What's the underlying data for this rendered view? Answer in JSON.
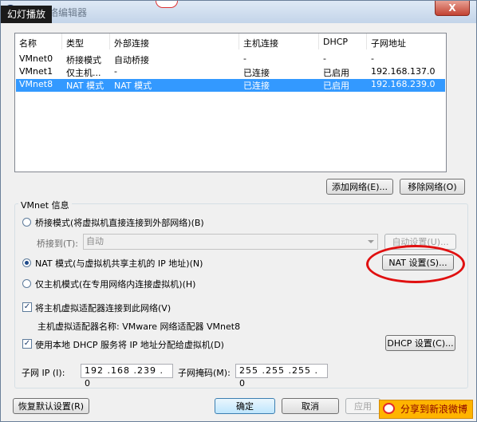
{
  "window": {
    "title": "虚拟网络编辑器",
    "close_label": "X"
  },
  "overlay": {
    "slideshow_label": "幻灯播放",
    "share_label": "分享到新浪微博"
  },
  "table": {
    "headers": [
      "名称",
      "类型",
      "外部连接",
      "主机连接",
      "DHCP",
      "子网地址"
    ],
    "rows": [
      {
        "name": "VMnet0",
        "type": "桥接模式",
        "external": "自动桥接",
        "host": "-",
        "dhcp": "-",
        "subnet": "-"
      },
      {
        "name": "VMnet1",
        "type": "仅主机...",
        "external": "-",
        "host": "已连接",
        "dhcp": "已启用",
        "subnet": "192.168.137.0"
      },
      {
        "name": "VMnet8",
        "type": "NAT 模式",
        "external": "NAT 模式",
        "host": "已连接",
        "dhcp": "已启用",
        "subnet": "192.168.239.0"
      }
    ],
    "selected_index": 2
  },
  "buttons": {
    "add_network": "添加网络(E)...",
    "remove_network": "移除网络(O)",
    "auto_settings": "自动设置(U)...",
    "nat_settings": "NAT 设置(S)...",
    "dhcp_settings": "DHCP 设置(C)...",
    "restore_defaults": "恢复默认设置(R)",
    "ok": "确定",
    "cancel": "取消",
    "apply": "应用"
  },
  "vmnet_info": {
    "group_title": "VMnet 信息",
    "bridge_mode": "桥接模式(将虚拟机直接连接到外部网络)(B)",
    "bridge_to_label": "桥接到(T):",
    "bridge_to_value": "自动",
    "nat_mode": "NAT 模式(与虚拟机共享主机的 IP 地址)(N)",
    "host_only_mode": "仅主机模式(在专用网络内连接虚拟机)(H)",
    "selected_mode": "nat",
    "connect_adapter": "将主机虚拟适配器连接到此网络(V)",
    "connect_adapter_checked": true,
    "adapter_name": "主机虚拟适配器名称: VMware 网络适配器 VMnet8",
    "use_dhcp": "使用本地 DHCP 服务将 IP 地址分配给虚拟机(D)",
    "use_dhcp_checked": true,
    "subnet_ip_label": "子网 IP (I):",
    "subnet_ip": "192 .168 .239 . 0",
    "subnet_mask_label": "子网掩码(M):",
    "subnet_mask": "255 .255 .255 . 0"
  },
  "colors": {
    "selection": "#3399ff",
    "annotation": "#e01010"
  }
}
